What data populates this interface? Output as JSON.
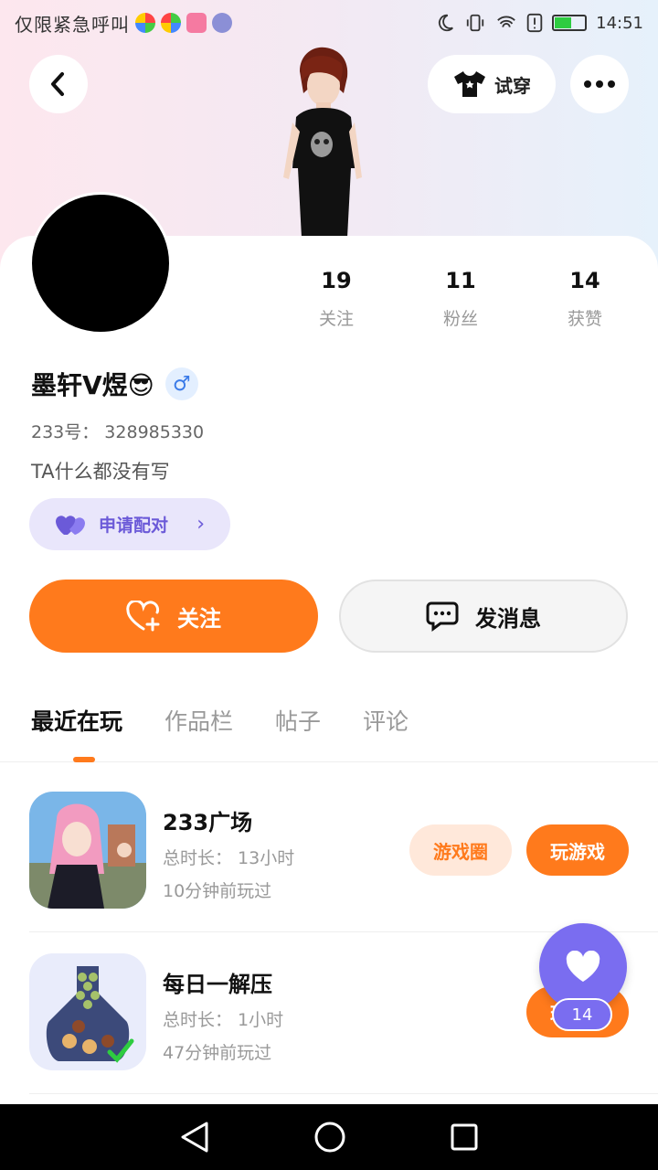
{
  "status_bar": {
    "carrier_text": "仅限紧急呼叫",
    "time": "14:51",
    "app_icons": [
      "app-icon-1",
      "app-icon-2",
      "bilibili-icon",
      "music-icon"
    ],
    "icons": [
      "moon-icon",
      "vibrate-icon",
      "wifi-icon",
      "alert-icon",
      "battery-icon"
    ]
  },
  "header": {
    "tryon_label": "试穿",
    "icons": [
      "back-icon",
      "shirt-icon",
      "more-icon"
    ]
  },
  "profile": {
    "stats": [
      {
        "value": "19",
        "label": "关注"
      },
      {
        "value": "11",
        "label": "粉丝"
      },
      {
        "value": "14",
        "label": "获赞"
      }
    ],
    "nickname": "墨轩V煜😎",
    "gender_symbol": "♂",
    "uid_text": "233号： 328985330",
    "bio": "TA什么都没有写",
    "pair_label": "申请配对"
  },
  "actions": {
    "follow_label": "关注",
    "message_label": "发消息"
  },
  "tabs": [
    "最近在玩",
    "作品栏",
    "帖子",
    "评论"
  ],
  "games": [
    {
      "title": "233广场",
      "duration": "总时长： 13小时",
      "last_played": "10分钟前玩过",
      "circle_label": "游戏圈",
      "play_label": "玩游戏"
    },
    {
      "title": "每日一解压",
      "duration": "总时长： 1小时",
      "last_played": "47分钟前玩过",
      "play_label": "玩游戏"
    }
  ],
  "fab": {
    "like_count": "14"
  },
  "colors": {
    "accent": "#ff7a1c",
    "purple": "#7a6df0"
  }
}
